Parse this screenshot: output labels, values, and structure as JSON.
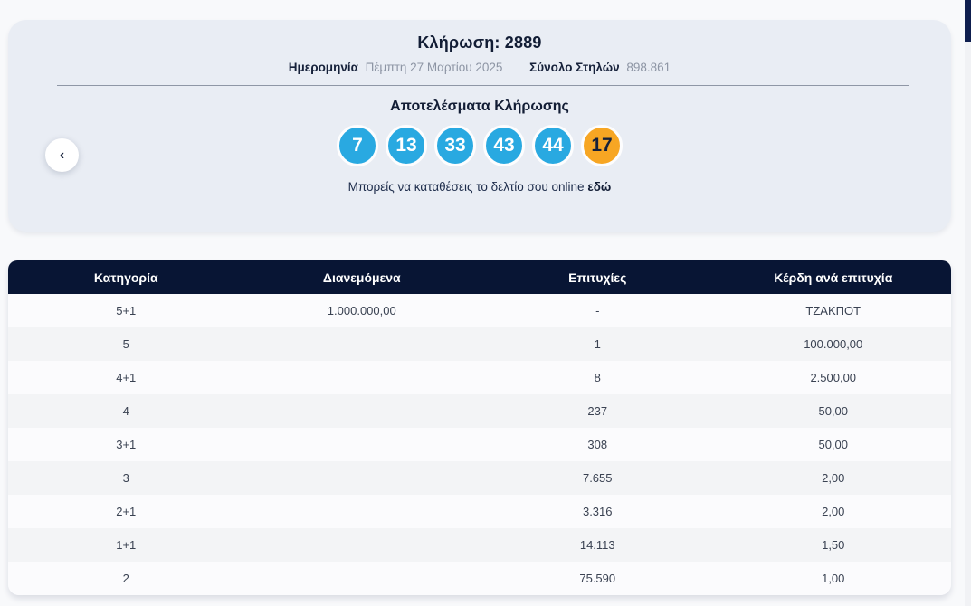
{
  "draw_panel": {
    "title": "Κλήρωση: 2889",
    "date_label": "Ημερομηνία",
    "date_value": "Πέμπτη 27 Μαρτίου 2025",
    "columns_label": "Σύνολο Στηλών",
    "columns_value": "898.861",
    "results_title": "Αποτελέσματα Κλήρωσης",
    "numbers": [
      {
        "value": "7",
        "type": "main"
      },
      {
        "value": "13",
        "type": "main"
      },
      {
        "value": "33",
        "type": "main"
      },
      {
        "value": "43",
        "type": "main"
      },
      {
        "value": "44",
        "type": "main"
      },
      {
        "value": "17",
        "type": "joker"
      }
    ],
    "note_text": "Μπορείς να καταθέσεις το δελτίο σου online",
    "note_link_label": "εδώ",
    "prev_arrow_glyph": "‹"
  },
  "colors": {
    "panel_bg": "#e9edf4",
    "main_ball": "#29a9e1",
    "joker_ball": "#f7a623",
    "table_header_bg": "#081534"
  },
  "table": {
    "headers": [
      "Κατηγορία",
      "Διανεμόμενα",
      "Επιτυχίες",
      "Κέρδη ανά επιτυχία"
    ],
    "rows": [
      [
        "5+1",
        "1.000.000,00",
        "-",
        "ΤΖΑΚΠΟΤ"
      ],
      [
        "5",
        "",
        "1",
        "100.000,00"
      ],
      [
        "4+1",
        "",
        "8",
        "2.500,00"
      ],
      [
        "4",
        "",
        "237",
        "50,00"
      ],
      [
        "3+1",
        "",
        "308",
        "50,00"
      ],
      [
        "3",
        "",
        "7.655",
        "2,00"
      ],
      [
        "2+1",
        "",
        "3.316",
        "2,00"
      ],
      [
        "1+1",
        "",
        "14.113",
        "1,50"
      ],
      [
        "2",
        "",
        "75.590",
        "1,00"
      ]
    ]
  }
}
